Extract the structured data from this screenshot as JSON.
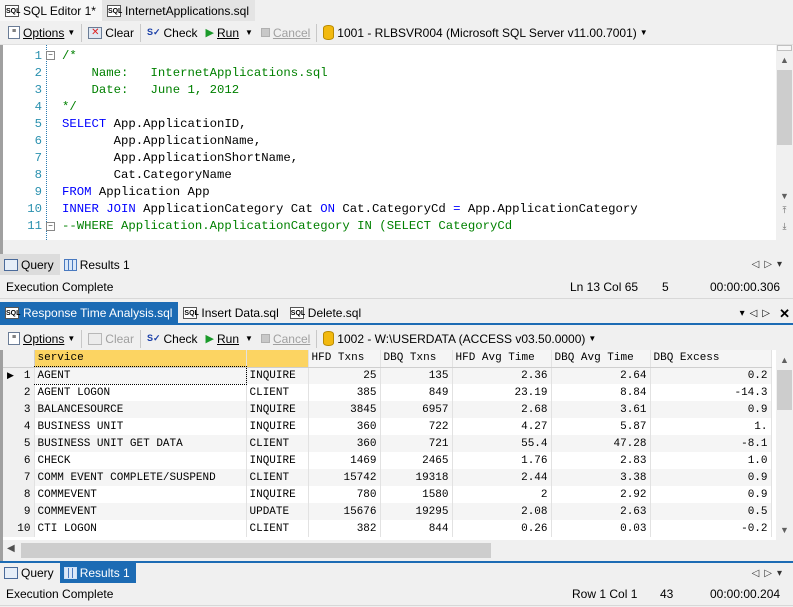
{
  "top_editor": {
    "tabs": [
      {
        "label": "SQL Editor 1*",
        "icon": "sql-file-icon",
        "active": true
      },
      {
        "label": "InternetApplications.sql",
        "icon": "sql-file-icon",
        "active": false
      }
    ],
    "toolbar": {
      "options": "Options",
      "clear": "Clear",
      "check": "Check",
      "run": "Run",
      "cancel": "Cancel",
      "connection": "1001 - RLBSVR004 (Microsoft SQL Server v11.00.7001)"
    },
    "code_lines": [
      {
        "n": "1",
        "parts": [
          {
            "t": "/*",
            "c": "cm"
          }
        ]
      },
      {
        "n": "2",
        "parts": [
          {
            "t": "    Name:   InternetApplications.sql",
            "c": "cm"
          }
        ]
      },
      {
        "n": "3",
        "parts": [
          {
            "t": "    Date:   June 1, 2012",
            "c": "cm"
          }
        ]
      },
      {
        "n": "4",
        "parts": [
          {
            "t": "*/",
            "c": "cm"
          }
        ]
      },
      {
        "n": "5",
        "parts": [
          {
            "t": "SELECT",
            "c": "kw"
          },
          {
            "t": " App.ApplicationID,",
            "c": ""
          }
        ]
      },
      {
        "n": "6",
        "parts": [
          {
            "t": "       App.ApplicationName,",
            "c": ""
          }
        ]
      },
      {
        "n": "7",
        "parts": [
          {
            "t": "       App.ApplicationShortName,",
            "c": ""
          }
        ]
      },
      {
        "n": "8",
        "parts": [
          {
            "t": "       Cat.CategoryName",
            "c": ""
          }
        ]
      },
      {
        "n": "9",
        "parts": [
          {
            "t": "FROM",
            "c": "kw"
          },
          {
            "t": " Application App",
            "c": ""
          }
        ]
      },
      {
        "n": "10",
        "parts": [
          {
            "t": "INNER JOIN",
            "c": "kw"
          },
          {
            "t": " ApplicationCategory Cat ",
            "c": ""
          },
          {
            "t": "ON",
            "c": "kw"
          },
          {
            "t": " Cat.CategoryCd ",
            "c": ""
          },
          {
            "t": "=",
            "c": "op"
          },
          {
            "t": " App.ApplicationCategory",
            "c": ""
          }
        ]
      },
      {
        "n": "11",
        "parts": [
          {
            "t": "--WHERE Application.ApplicationCategory IN (SELECT CategoryCd",
            "c": "cm"
          }
        ]
      }
    ],
    "result_tabs": [
      {
        "label": "Query",
        "active": true
      },
      {
        "label": "Results 1",
        "active": false
      }
    ],
    "status": {
      "message": "Execution Complete",
      "position": "Ln 13 Col 65",
      "count": "5",
      "elapsed": "00:00:00.306"
    }
  },
  "bottom_editor": {
    "tabs": [
      {
        "label": "Response Time Analysis.sql",
        "active": true
      },
      {
        "label": "Insert Data.sql",
        "active": false
      },
      {
        "label": "Delete.sql",
        "active": false
      }
    ],
    "toolbar": {
      "options": "Options",
      "clear": "Clear",
      "check": "Check",
      "run": "Run",
      "cancel": "Cancel",
      "connection": "1002 - W:\\USERDATA (ACCESS v03.50.0000)"
    },
    "grid": {
      "columns": [
        "service",
        "",
        "HFD Txns",
        "DBQ Txns",
        "HFD Avg Time",
        "DBQ Avg Time",
        "DBQ Excess"
      ],
      "rows": [
        [
          "1",
          "AGENT",
          "INQUIRE",
          "25",
          "135",
          "2.36",
          "2.64",
          "0.2"
        ],
        [
          "2",
          "AGENT LOGON",
          "CLIENT",
          "385",
          "849",
          "23.19",
          "8.84",
          "-14.3"
        ],
        [
          "3",
          "BALANCESOURCE",
          "INQUIRE",
          "3845",
          "6957",
          "2.68",
          "3.61",
          "0.9"
        ],
        [
          "4",
          "BUSINESS UNIT",
          "INQUIRE",
          "360",
          "722",
          "4.27",
          "5.87",
          "1."
        ],
        [
          "5",
          "BUSINESS UNIT GET DATA",
          "CLIENT",
          "360",
          "721",
          "55.4",
          "47.28",
          "-8.1"
        ],
        [
          "6",
          "CHECK",
          "INQUIRE",
          "1469",
          "2465",
          "1.76",
          "2.83",
          "1.0"
        ],
        [
          "7",
          "COMM EVENT COMPLETE/SUSPEND",
          "CLIENT",
          "15742",
          "19318",
          "2.44",
          "3.38",
          "0.9"
        ],
        [
          "8",
          "COMMEVENT",
          "INQUIRE",
          "780",
          "1580",
          "2",
          "2.92",
          "0.9"
        ],
        [
          "9",
          "COMMEVENT",
          "UPDATE",
          "15676",
          "19295",
          "2.08",
          "2.63",
          "0.5"
        ],
        [
          "10",
          "CTI LOGON",
          "CLIENT",
          "382",
          "844",
          "0.26",
          "0.03",
          "-0.2"
        ]
      ]
    },
    "result_tabs": [
      {
        "label": "Query",
        "active": false
      },
      {
        "label": "Results 1",
        "active": true
      }
    ],
    "status": {
      "message": "Execution Complete",
      "position": "Row 1 Col 1",
      "count": "43",
      "elapsed": "00:00:00.204"
    }
  }
}
